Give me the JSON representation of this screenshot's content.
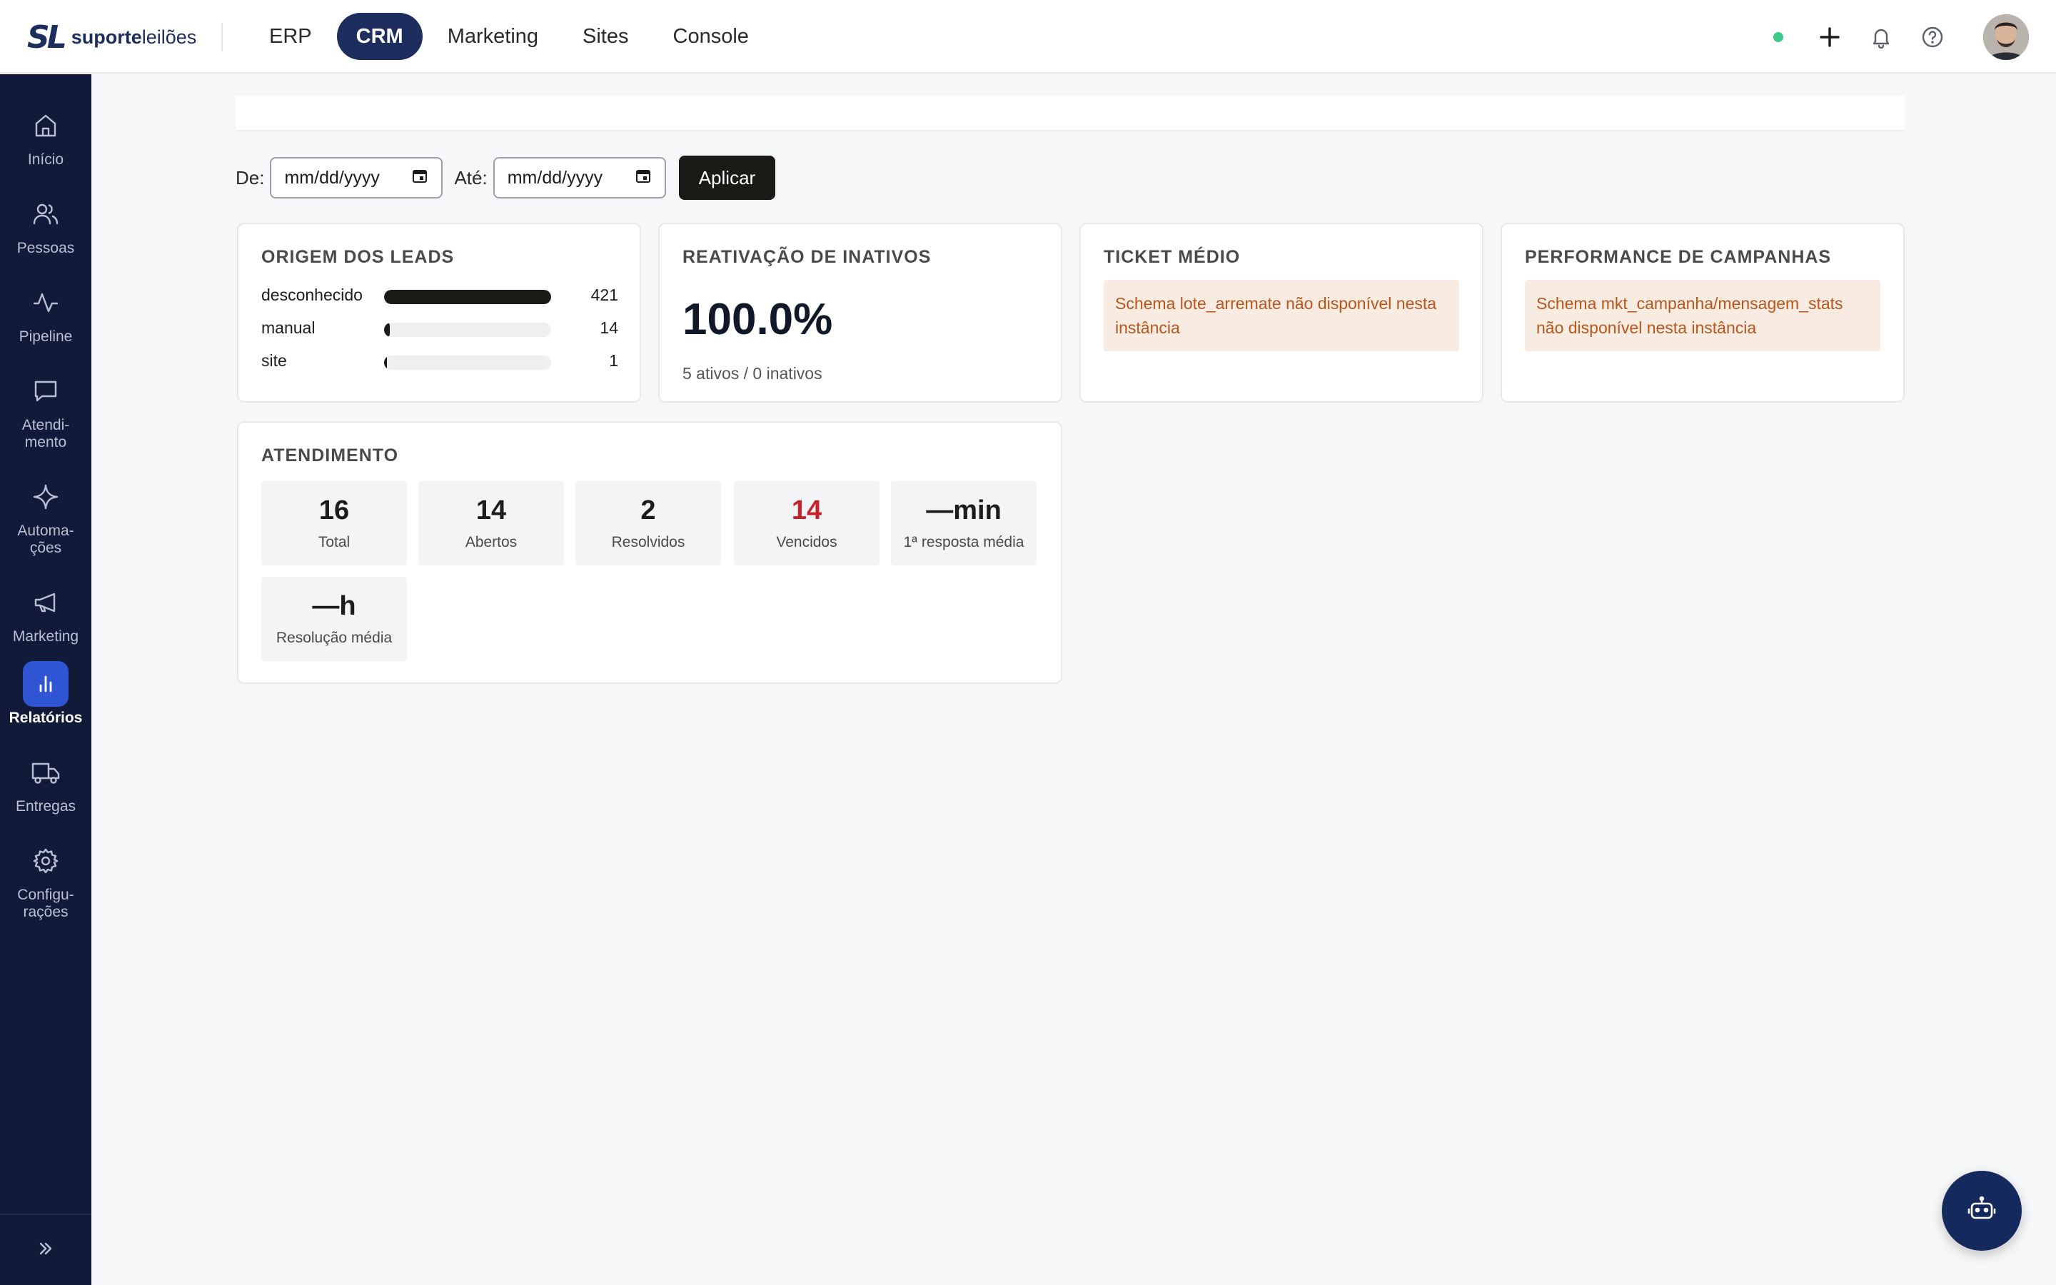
{
  "header": {
    "logo_mark": "SL",
    "logo_bold": "suporte",
    "logo_light": "leilões",
    "nav": [
      {
        "label": "ERP",
        "active": false
      },
      {
        "label": "CRM",
        "active": true
      },
      {
        "label": "Marketing",
        "active": false
      },
      {
        "label": "Sites",
        "active": false
      },
      {
        "label": "Console",
        "active": false
      }
    ],
    "status_color": "#3ec98a"
  },
  "sidebar": {
    "items": [
      {
        "label": "Início",
        "icon": "home-icon"
      },
      {
        "label": "Pessoas",
        "icon": "users-icon"
      },
      {
        "label": "Pipeline",
        "icon": "activity-icon"
      },
      {
        "label": "Atendi-\nmento",
        "icon": "message-icon"
      },
      {
        "label": "Automa-\nções",
        "icon": "sparkle-icon"
      },
      {
        "label": "Marketing",
        "icon": "megaphone-icon"
      },
      {
        "label": "Relatórios",
        "icon": "bar-chart-icon",
        "active": true
      },
      {
        "label": "Entregas",
        "icon": "truck-icon"
      },
      {
        "label": "Configu-\nrações",
        "icon": "gear-icon"
      }
    ]
  },
  "filters": {
    "from_label": "De:",
    "from_placeholder": "mm/dd/yyyy",
    "to_label": "Até:",
    "to_placeholder": "mm/dd/yyyy",
    "apply_label": "Aplicar"
  },
  "leads": {
    "title": "Origem dos leads",
    "rows": [
      {
        "label": "desconhecido",
        "value": "421",
        "share": 1.0
      },
      {
        "label": "manual",
        "value": "14",
        "share": 0.033
      },
      {
        "label": "site",
        "value": "1",
        "share": 0.0024
      }
    ]
  },
  "reactivation": {
    "title": "Reativação de inativos",
    "value": "100.0%",
    "sub": "5 ativos / 0 inativos"
  },
  "ticket": {
    "title": "Ticket médio",
    "warning": "Schema lote_arremate não disponível nesta instância"
  },
  "campaigns": {
    "title": "Performance de campanhas",
    "warning": "Schema mkt_campanha/mensagem_stats não disponível nesta instância"
  },
  "service": {
    "title": "Atendimento",
    "stats": [
      {
        "value": "16",
        "label": "Total",
        "alert": false
      },
      {
        "value": "14",
        "label": "Abertos",
        "alert": false
      },
      {
        "value": "2",
        "label": "Resolvidos",
        "alert": false
      },
      {
        "value": "14",
        "label": "Vencidos",
        "alert": true
      },
      {
        "value": "—min",
        "label": "1ª resposta média",
        "alert": false
      },
      {
        "value": "—h",
        "label": "Resolução média",
        "alert": false
      }
    ]
  },
  "colors": {
    "sidebar_bg": "#111a38",
    "brand": "#1c2d5e",
    "active_side": "#2f55d4",
    "alert_red": "#c4242e",
    "warning_bg": "#f8ebe2",
    "warning_text": "#b8561b"
  }
}
